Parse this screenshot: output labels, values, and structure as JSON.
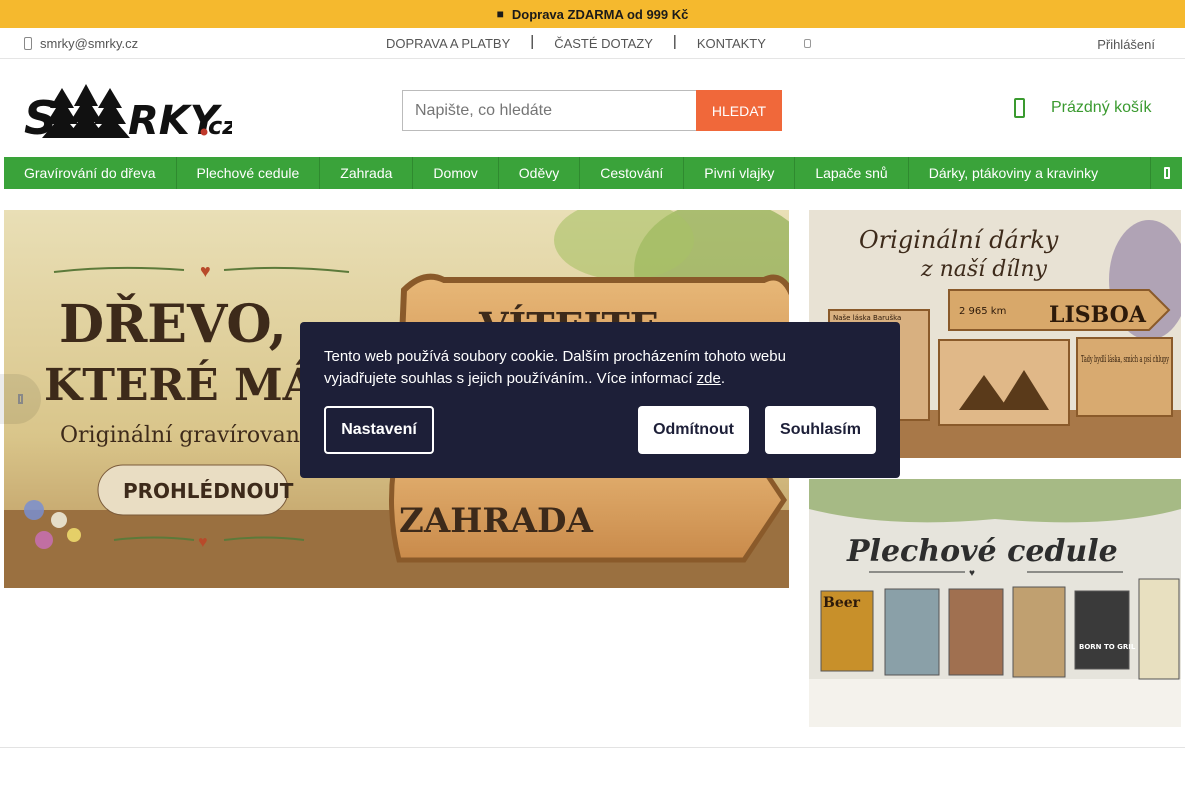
{
  "topbar": {
    "text": "Doprava ZDARMA od 999 Kč",
    "icon": "truck-icon",
    "bg": "#f5b92e"
  },
  "util": {
    "email": "smrky@smrky.cz",
    "links": [
      "DOPRAVA A PLATBY",
      "ČASTÉ DOTAZY",
      "KONTAKTY"
    ],
    "login": "Přihlášení"
  },
  "header": {
    "logo_text": "SMRKY.cz",
    "search_placeholder": "Napište, co hledáte",
    "search_button": "HLEDAT",
    "cart": "Prázdný košík"
  },
  "categories": [
    "Gravírování do dřeva",
    "Plechové cedule",
    "Zahrada",
    "Domov",
    "Oděvy",
    "Cestování",
    "Pivní vlajky",
    "Lapače snů",
    "Dárky, ptákoviny a kravinky"
  ],
  "hero": {
    "title1": "DŘEVO,",
    "title2": "KTERÉ MÁ DUŠI",
    "subtitle": "Originální gravírované cedule",
    "cta": "PROHLÉDNOUT",
    "sign1": "VÍTEJTE",
    "sign2": "ZAHRADA"
  },
  "side1": {
    "title1": "Originální dárky",
    "title2": "z naší dílny",
    "sign_lisboa": "LISBOA",
    "distance": "2 965 km",
    "plaque": "Tady bydlí láska, smích a psí chlupy",
    "caption": "Naše láska Baruška"
  },
  "side2": {
    "title": "Plechové cedule",
    "beer": "Beer",
    "grill": "BORN TO GRIL"
  },
  "cookie": {
    "text": "Tento web používá soubory cookie. Dalším procházením tohoto webu vyjadřujete souhlas s jejich používáním.. Více informací ",
    "link": "zde",
    "end": ".",
    "settings": "Nastavení",
    "reject": "Odmítnout",
    "accept": "Souhlasím"
  },
  "colors": {
    "green": "#3aa33a",
    "orange": "#f0683a",
    "navy": "#1d1f38"
  }
}
